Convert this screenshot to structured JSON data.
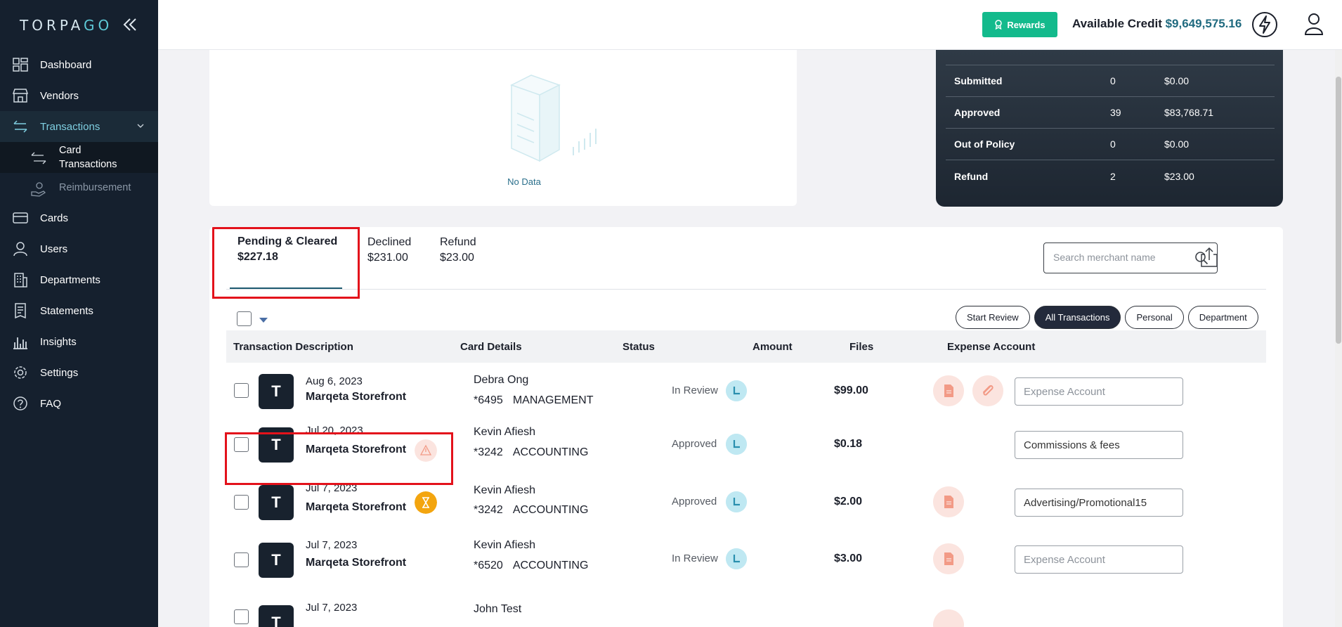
{
  "app": {
    "logo_part1": "TORPA",
    "logo_part2": "GO"
  },
  "sidebar": {
    "items": [
      {
        "label": "Dashboard"
      },
      {
        "label": "Vendors"
      },
      {
        "label": "Transactions"
      },
      {
        "label": "Cards"
      },
      {
        "label": "Users"
      },
      {
        "label": "Departments"
      },
      {
        "label": "Statements"
      },
      {
        "label": "Insights"
      },
      {
        "label": "Settings"
      },
      {
        "label": "FAQ"
      }
    ],
    "sub_items": [
      {
        "label_line1": "Card",
        "label_line2": "Transactions"
      },
      {
        "label": "Reimbursement"
      }
    ]
  },
  "header": {
    "rewards_label": "Rewards",
    "credit_label": "Available Credit",
    "credit_value": "$9,649,575.16"
  },
  "nodata": {
    "text": "No Data"
  },
  "stats": [
    {
      "label": "Submitted",
      "count": "0",
      "amount": "$0.00"
    },
    {
      "label": "Approved",
      "count": "39",
      "amount": "$83,768.71"
    },
    {
      "label": "Out of Policy",
      "count": "0",
      "amount": "$0.00"
    },
    {
      "label": "Refund",
      "count": "2",
      "amount": "$23.00"
    }
  ],
  "tabs": [
    {
      "label": "Pending & Cleared",
      "amount": "$227.18"
    },
    {
      "label": "Declined",
      "amount": "$231.00"
    },
    {
      "label": "Refund",
      "amount": "$23.00"
    }
  ],
  "search": {
    "placeholder": "Search merchant name"
  },
  "filters": [
    {
      "label": "Start Review"
    },
    {
      "label": "All Transactions"
    },
    {
      "label": "Personal"
    },
    {
      "label": "Department"
    }
  ],
  "table": {
    "headers": [
      "Transaction Description",
      "Card Details",
      "Status",
      "Amount",
      "Files",
      "Expense Account"
    ],
    "rows": [
      {
        "avatar": "T",
        "date": "Aug 6, 2023",
        "merchant": "Marqeta Storefront",
        "holder": "Debra Ong",
        "card": "*6495",
        "dept": "MANAGEMENT",
        "status": "In Review",
        "amount": "$99.00",
        "expense": "",
        "expense_placeholder": "Expense Account"
      },
      {
        "avatar": "T",
        "date": "Jul 20, 2023",
        "merchant": "Marqeta Storefront",
        "holder": "Kevin Afiesh",
        "card": "*3242",
        "dept": "ACCOUNTING",
        "status": "Approved",
        "amount": "$0.18",
        "expense": "Commissions & fees",
        "expense_placeholder": ""
      },
      {
        "avatar": "T",
        "date": "Jul 7, 2023",
        "merchant": "Marqeta Storefront",
        "holder": "Kevin Afiesh",
        "card": "*3242",
        "dept": "ACCOUNTING",
        "status": "Approved",
        "amount": "$2.00",
        "expense": "Advertising/Promotional15",
        "expense_placeholder": ""
      },
      {
        "avatar": "T",
        "date": "Jul 7, 2023",
        "merchant": "Marqeta Storefront",
        "holder": "Kevin Afiesh",
        "card": "*6520",
        "dept": "ACCOUNTING",
        "status": "In Review",
        "amount": "$3.00",
        "expense": "",
        "expense_placeholder": "Expense Account"
      },
      {
        "avatar": "T",
        "date": "Jul 7, 2023",
        "merchant": "",
        "holder": "John Test",
        "card": "",
        "dept": "",
        "status": "",
        "amount": "",
        "expense": "",
        "expense_placeholder": ""
      }
    ]
  },
  "colors": {
    "accent": "#13ba8c",
    "sidebar": "#15202e",
    "highlight": "#e3121b"
  }
}
